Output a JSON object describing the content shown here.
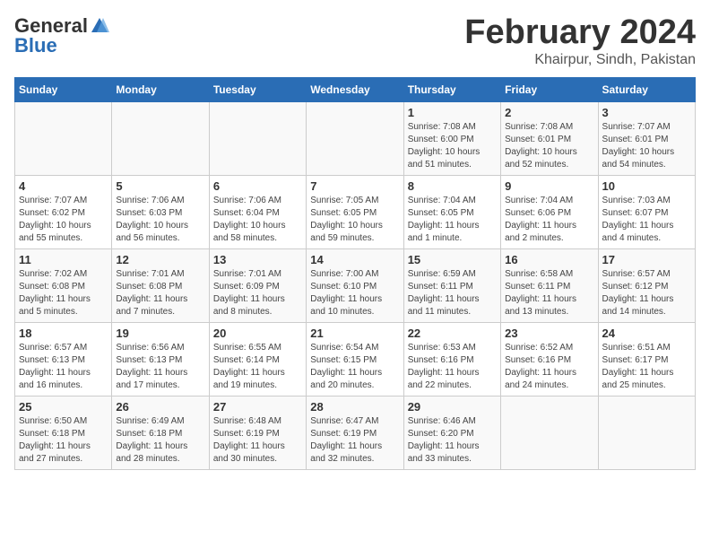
{
  "header": {
    "logo_line1": "General",
    "logo_line2": "Blue",
    "main_title": "February 2024",
    "subtitle": "Khairpur, Sindh, Pakistan"
  },
  "calendar": {
    "days_of_week": [
      "Sunday",
      "Monday",
      "Tuesday",
      "Wednesday",
      "Thursday",
      "Friday",
      "Saturday"
    ],
    "weeks": [
      [
        {
          "day": "",
          "info": ""
        },
        {
          "day": "",
          "info": ""
        },
        {
          "day": "",
          "info": ""
        },
        {
          "day": "",
          "info": ""
        },
        {
          "day": "1",
          "info": "Sunrise: 7:08 AM\nSunset: 6:00 PM\nDaylight: 10 hours\nand 51 minutes."
        },
        {
          "day": "2",
          "info": "Sunrise: 7:08 AM\nSunset: 6:01 PM\nDaylight: 10 hours\nand 52 minutes."
        },
        {
          "day": "3",
          "info": "Sunrise: 7:07 AM\nSunset: 6:01 PM\nDaylight: 10 hours\nand 54 minutes."
        }
      ],
      [
        {
          "day": "4",
          "info": "Sunrise: 7:07 AM\nSunset: 6:02 PM\nDaylight: 10 hours\nand 55 minutes."
        },
        {
          "day": "5",
          "info": "Sunrise: 7:06 AM\nSunset: 6:03 PM\nDaylight: 10 hours\nand 56 minutes."
        },
        {
          "day": "6",
          "info": "Sunrise: 7:06 AM\nSunset: 6:04 PM\nDaylight: 10 hours\nand 58 minutes."
        },
        {
          "day": "7",
          "info": "Sunrise: 7:05 AM\nSunset: 6:05 PM\nDaylight: 10 hours\nand 59 minutes."
        },
        {
          "day": "8",
          "info": "Sunrise: 7:04 AM\nSunset: 6:05 PM\nDaylight: 11 hours\nand 1 minute."
        },
        {
          "day": "9",
          "info": "Sunrise: 7:04 AM\nSunset: 6:06 PM\nDaylight: 11 hours\nand 2 minutes."
        },
        {
          "day": "10",
          "info": "Sunrise: 7:03 AM\nSunset: 6:07 PM\nDaylight: 11 hours\nand 4 minutes."
        }
      ],
      [
        {
          "day": "11",
          "info": "Sunrise: 7:02 AM\nSunset: 6:08 PM\nDaylight: 11 hours\nand 5 minutes."
        },
        {
          "day": "12",
          "info": "Sunrise: 7:01 AM\nSunset: 6:08 PM\nDaylight: 11 hours\nand 7 minutes."
        },
        {
          "day": "13",
          "info": "Sunrise: 7:01 AM\nSunset: 6:09 PM\nDaylight: 11 hours\nand 8 minutes."
        },
        {
          "day": "14",
          "info": "Sunrise: 7:00 AM\nSunset: 6:10 PM\nDaylight: 11 hours\nand 10 minutes."
        },
        {
          "day": "15",
          "info": "Sunrise: 6:59 AM\nSunset: 6:11 PM\nDaylight: 11 hours\nand 11 minutes."
        },
        {
          "day": "16",
          "info": "Sunrise: 6:58 AM\nSunset: 6:11 PM\nDaylight: 11 hours\nand 13 minutes."
        },
        {
          "day": "17",
          "info": "Sunrise: 6:57 AM\nSunset: 6:12 PM\nDaylight: 11 hours\nand 14 minutes."
        }
      ],
      [
        {
          "day": "18",
          "info": "Sunrise: 6:57 AM\nSunset: 6:13 PM\nDaylight: 11 hours\nand 16 minutes."
        },
        {
          "day": "19",
          "info": "Sunrise: 6:56 AM\nSunset: 6:13 PM\nDaylight: 11 hours\nand 17 minutes."
        },
        {
          "day": "20",
          "info": "Sunrise: 6:55 AM\nSunset: 6:14 PM\nDaylight: 11 hours\nand 19 minutes."
        },
        {
          "day": "21",
          "info": "Sunrise: 6:54 AM\nSunset: 6:15 PM\nDaylight: 11 hours\nand 20 minutes."
        },
        {
          "day": "22",
          "info": "Sunrise: 6:53 AM\nSunset: 6:16 PM\nDaylight: 11 hours\nand 22 minutes."
        },
        {
          "day": "23",
          "info": "Sunrise: 6:52 AM\nSunset: 6:16 PM\nDaylight: 11 hours\nand 24 minutes."
        },
        {
          "day": "24",
          "info": "Sunrise: 6:51 AM\nSunset: 6:17 PM\nDaylight: 11 hours\nand 25 minutes."
        }
      ],
      [
        {
          "day": "25",
          "info": "Sunrise: 6:50 AM\nSunset: 6:18 PM\nDaylight: 11 hours\nand 27 minutes."
        },
        {
          "day": "26",
          "info": "Sunrise: 6:49 AM\nSunset: 6:18 PM\nDaylight: 11 hours\nand 28 minutes."
        },
        {
          "day": "27",
          "info": "Sunrise: 6:48 AM\nSunset: 6:19 PM\nDaylight: 11 hours\nand 30 minutes."
        },
        {
          "day": "28",
          "info": "Sunrise: 6:47 AM\nSunset: 6:19 PM\nDaylight: 11 hours\nand 32 minutes."
        },
        {
          "day": "29",
          "info": "Sunrise: 6:46 AM\nSunset: 6:20 PM\nDaylight: 11 hours\nand 33 minutes."
        },
        {
          "day": "",
          "info": ""
        },
        {
          "day": "",
          "info": ""
        }
      ]
    ]
  }
}
